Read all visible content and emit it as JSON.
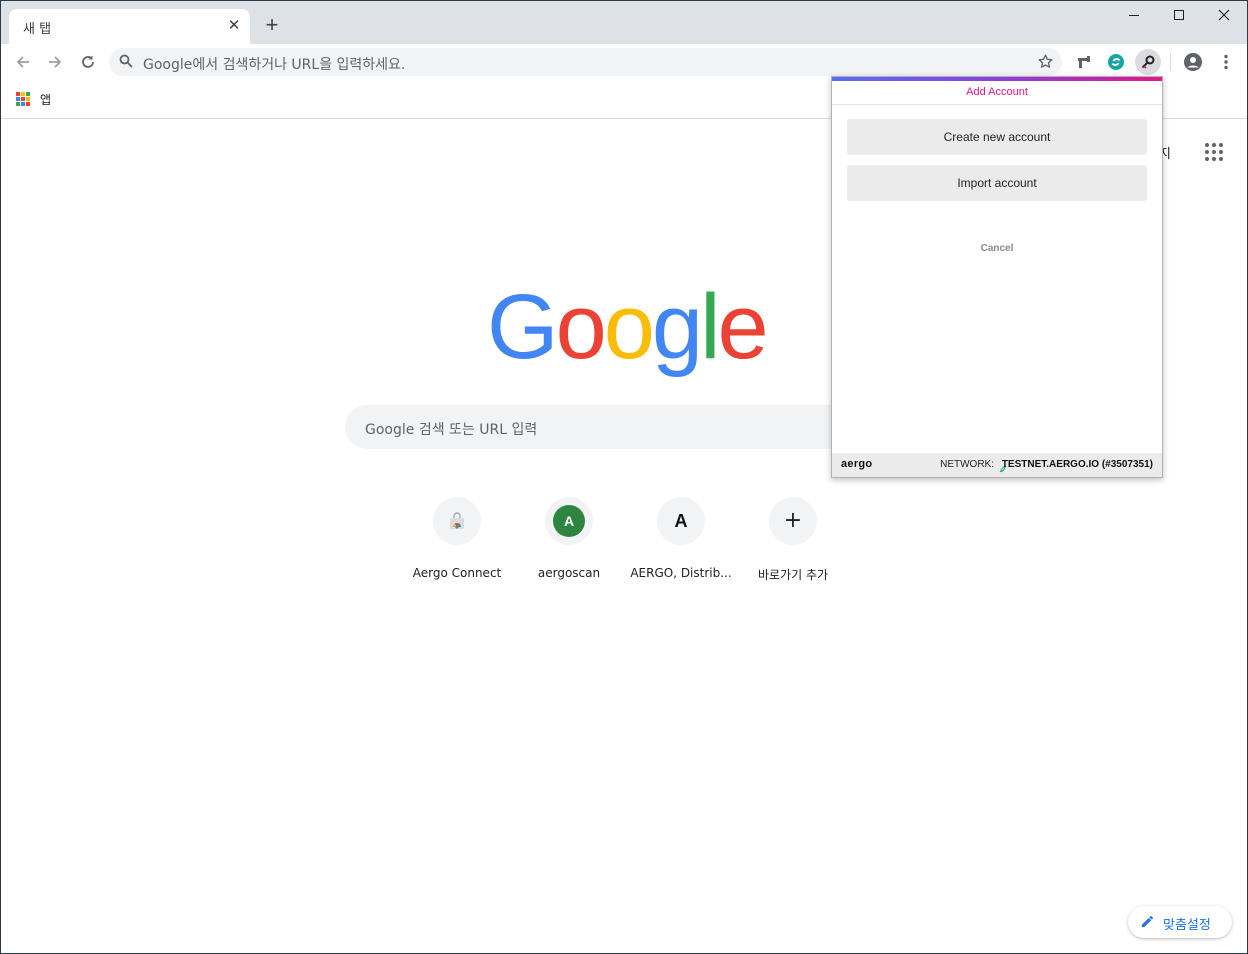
{
  "tab": {
    "title": "새 탭"
  },
  "omnibox": {
    "placeholder": "Google에서 검색하거나 URL을 입력하세요."
  },
  "bookmarks": {
    "apps_label": "앱"
  },
  "ntp": {
    "topright_text": "지",
    "search_placeholder": "Google 검색 또는 URL 입력",
    "logo_letters": [
      "G",
      "o",
      "o",
      "g",
      "l",
      "e"
    ],
    "logo_colors": [
      "#4285f4",
      "#ea4335",
      "#fbbc05",
      "#4285f4",
      "#34a853",
      "#ea4335"
    ],
    "tiles": [
      {
        "label": "Aergo Connect",
        "icon": "chrome-webstore-icon"
      },
      {
        "label": "aergoscan",
        "icon": "A"
      },
      {
        "label": "AERGO, Distrib...",
        "icon": "A"
      },
      {
        "label": "바로가기 추가",
        "icon": "+"
      }
    ],
    "customize_label": "맞춤설정"
  },
  "popup": {
    "title": "Add Account",
    "create_label": "Create new account",
    "import_label": "Import account",
    "cancel_label": "Cancel",
    "footer_logo": "aergo",
    "network_label": "NETWORK:",
    "network_value": "TESTNET.AERGO.IO (#3507351)"
  },
  "colors": {
    "accent_pink": "#e5158a",
    "accent_blue": "#1a73e8",
    "aergoscan_green": "#2e8540"
  }
}
